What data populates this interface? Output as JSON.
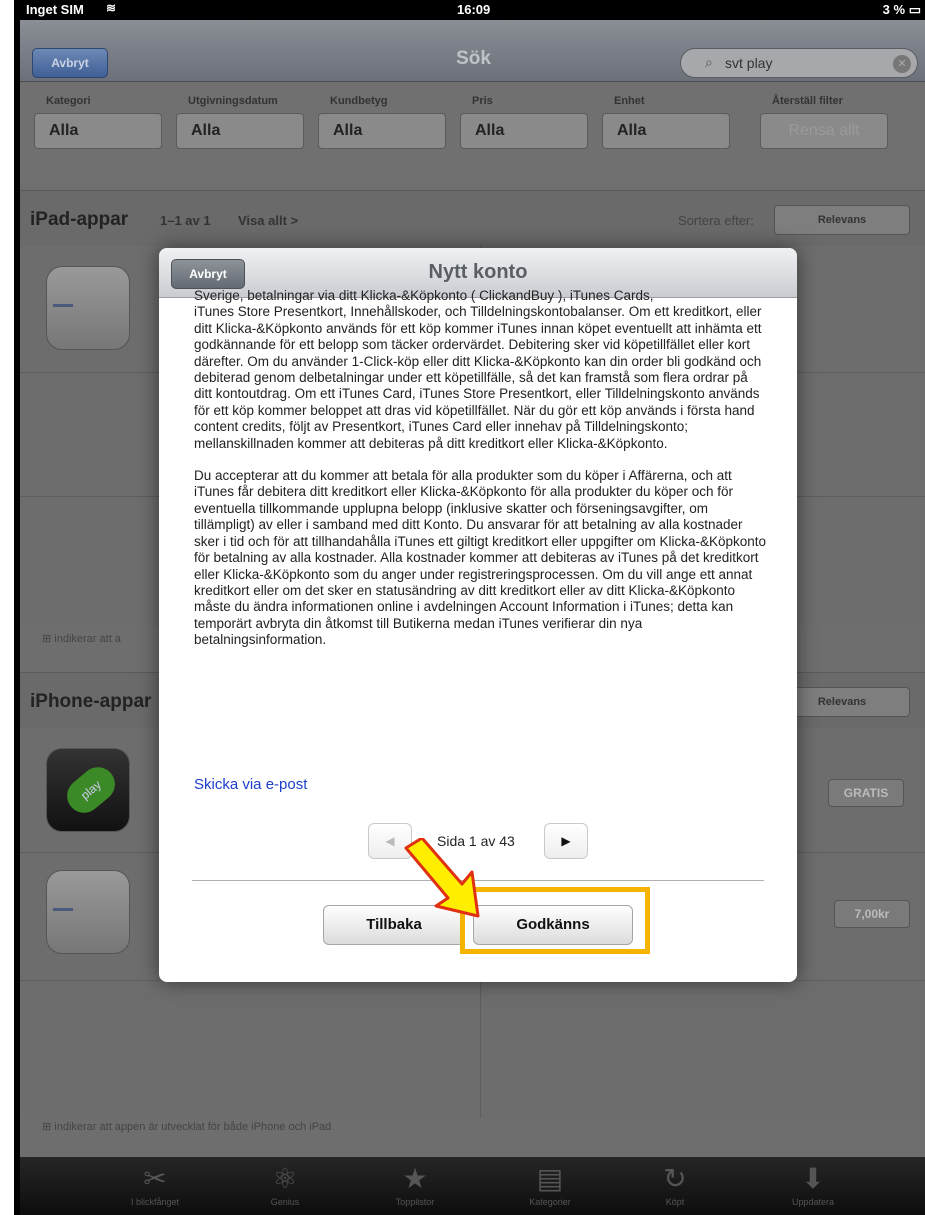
{
  "status": {
    "carrier": "Inget SIM",
    "time": "16:09",
    "battery": "3 %"
  },
  "nav": {
    "cancel_label": "Avbryt",
    "title": "Sök",
    "search_value": "svt play"
  },
  "filters": [
    {
      "label": "Kategori",
      "value": "Alla"
    },
    {
      "label": "Utgivningsdatum",
      "value": "Alla"
    },
    {
      "label": "Kundbetyg",
      "value": "Alla"
    },
    {
      "label": "Pris",
      "value": "Alla"
    },
    {
      "label": "Enhet",
      "value": "Alla"
    },
    {
      "label": "Återställ filter",
      "value": "Rensa allt"
    }
  ],
  "ipad_section": {
    "title": "iPad-appar",
    "count": "1–1 av 1",
    "see_all": "Visa allt >",
    "sort_label": "Sortera efter:",
    "sort_value": "Relevans"
  },
  "iphone_section": {
    "title": "iPhone-appar",
    "sort_value": "Relevans"
  },
  "notes": {
    "short": "indikerar att a",
    "full": "indikerar att appen är utvecklat för både iPhone och iPad"
  },
  "prices": {
    "free": "GRATIS",
    "paid": "7,00kr"
  },
  "tabs": [
    {
      "label": "I blickfånget",
      "icon": "scissors-icon",
      "glyph": "✂"
    },
    {
      "label": "Genius",
      "icon": "atom-icon",
      "glyph": "⚛"
    },
    {
      "label": "Topplistor",
      "icon": "star-icon",
      "glyph": "★"
    },
    {
      "label": "Kategorier",
      "icon": "stack-icon",
      "glyph": "▤"
    },
    {
      "label": "Köpt",
      "icon": "refresh-icon",
      "glyph": "↻"
    },
    {
      "label": "Uppdatera",
      "icon": "download-icon",
      "glyph": "⬇"
    }
  ],
  "modal": {
    "cancel_label": "Avbryt",
    "title": "Nytt konto",
    "para1_cut": "Sverige, betalningar via ditt Klicka-&Köpkonto ( ClickandBuy ), iTunes Cards,",
    "para1": "iTunes Store Presentkort, Innehållskoder, och Tilldelningskontobalanser. Om ett kreditkort, eller ditt Klicka-&Köpkonto används för ett köp kommer iTunes innan köpet eventuellt att inhämta ett godkännande för ett belopp som täcker ordervärdet. Debitering sker vid köpetillfället eller kort därefter. Om du använder 1-Click-köp eller ditt Klicka-&Köpkonto kan din order bli godkänd och debiterad genom delbetalningar under ett köpetillfälle, så det kan framstå som flera ordrar på ditt kontoutdrag. Om ett iTunes Card, iTunes Store Presentkort, eller Tilldelningskonto används för ett köp kommer beloppet att dras vid köpetillfället. När du gör ett köp används i första hand content credits, följt av Presentkort, iTunes Card eller innehav på Tilldelningskonto; mellanskillnaden kommer att debiteras på ditt kreditkort eller Klicka-&Köpkonto.",
    "para2": "Du accepterar att du kommer att betala för alla produkter som du köper i Affärerna, och att iTunes får debitera ditt kreditkort eller Klicka-&Köpkonto för alla produkter du köper och för eventuella tillkommande upplupna belopp (inklusive skatter och förseningsavgifter, om tillämpligt) av eller i samband med ditt Konto. Du ansvarar för att betalning av alla kostnader sker i tid och för att tillhandahålla iTunes ett giltigt kreditkort eller uppgifter om Klicka-&Köpkonto för betalning av alla kostnader. Alla kostnader kommer att debiteras av iTunes på det kreditkort eller Klicka-&Köpkonto som du anger under registreringsprocessen. Om du vill ange ett annat kreditkort eller om det sker en statusändring av ditt kreditkort eller av ditt Klicka-&Köpkonto måste du ändra informationen online i avdelningen Account Information i iTunes; detta kan temporärt avbryta din åtkomst till Butikerna medan iTunes verifierar din nya betalningsinformation.",
    "email_link": "Skicka via e-post",
    "page_text": "Sida 1 av 43",
    "back_label": "Tillbaka",
    "accept_label": "Godkänns"
  },
  "colors": {
    "highlight": "#f6b400",
    "arrow_fill": "#ffee00",
    "arrow_stroke": "#e03010",
    "link": "#1d3fcc"
  }
}
